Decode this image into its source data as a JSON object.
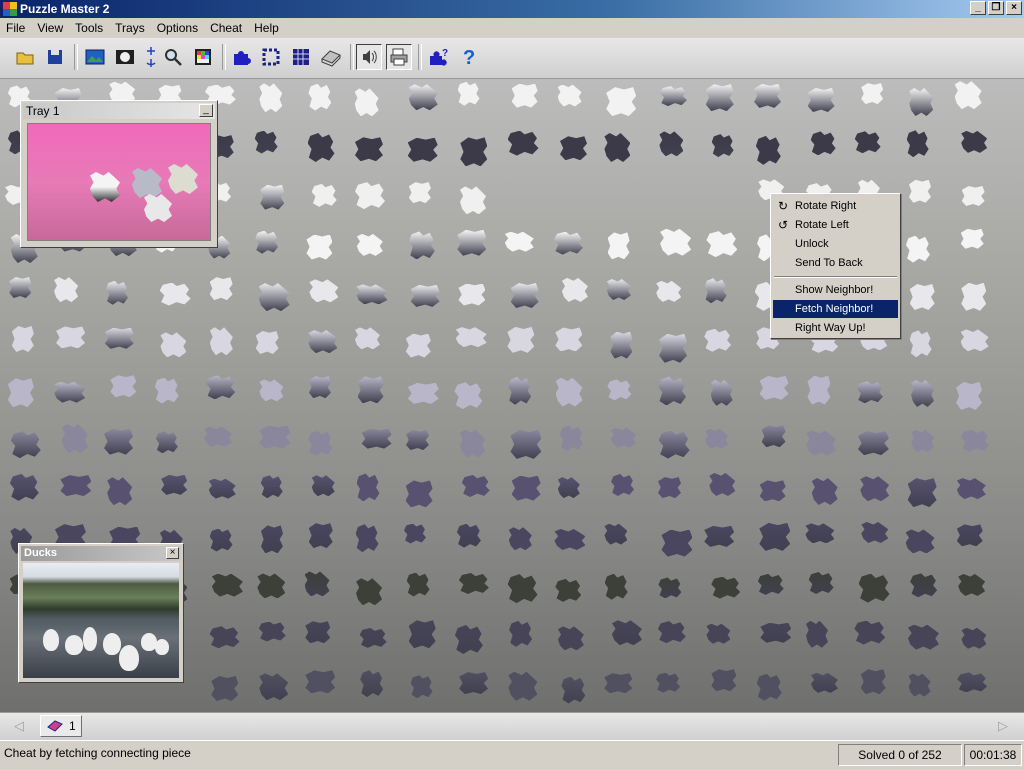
{
  "window": {
    "title": "Puzzle Master 2"
  },
  "menubar": {
    "items": [
      "File",
      "View",
      "Tools",
      "Trays",
      "Options",
      "Cheat",
      "Help"
    ]
  },
  "toolbar": {
    "buttons": [
      {
        "icon": "open-folder-icon",
        "color": "#c8a020"
      },
      {
        "icon": "save-disk-icon",
        "color": "#2040a0"
      },
      {
        "icon": "picture-icon",
        "color": "#2060c0"
      },
      {
        "icon": "dog-picture-icon",
        "color": "#404040"
      },
      {
        "icon": "resize-arrows-icon",
        "color": "#2040c0"
      },
      {
        "icon": "magnifier-icon",
        "color": "#404040"
      },
      {
        "icon": "color-grid-icon",
        "color": "#c03030"
      },
      {
        "icon": "puzzle-piece-icon",
        "color": "#2020c0"
      },
      {
        "icon": "dashed-square-icon",
        "color": "#202080"
      },
      {
        "icon": "grid-icon",
        "color": "#202080"
      },
      {
        "icon": "tray-icon",
        "color": "#404040"
      },
      {
        "icon": "sound-icon",
        "color": "#404040"
      },
      {
        "icon": "print-icon",
        "color": "#404040"
      },
      {
        "icon": "piece-help-icon",
        "color": "#2020c0"
      },
      {
        "icon": "help-question-icon",
        "color": "#1060d0"
      }
    ]
  },
  "tray": {
    "title": "Tray 1",
    "minimize": "_"
  },
  "preview": {
    "title": "Ducks",
    "close": "×"
  },
  "context_menu": {
    "items": [
      {
        "label": "Rotate Right",
        "icon": "rotate-right-icon",
        "glyph": "↻"
      },
      {
        "label": "Rotate Left",
        "icon": "rotate-left-icon",
        "glyph": "↺"
      },
      {
        "label": "Unlock",
        "icon": "",
        "glyph": ""
      },
      {
        "label": "Send To Back",
        "icon": "",
        "glyph": ""
      },
      {
        "label": "Show Neighbor!",
        "icon": "",
        "glyph": ""
      },
      {
        "label": "Fetch Neighbor!",
        "icon": "",
        "glyph": "",
        "selected": true
      },
      {
        "label": "Right Way Up!",
        "icon": "",
        "glyph": ""
      }
    ]
  },
  "tabs": [
    {
      "label": "1"
    }
  ],
  "statusbar": {
    "message": "Cheat by fetching connecting piece",
    "solved": "Solved 0 of 252",
    "time": "00:01:38"
  },
  "colors": {
    "selection": "#0a246a",
    "tray_background": "#f06aba",
    "title_active": "#0a246a"
  }
}
